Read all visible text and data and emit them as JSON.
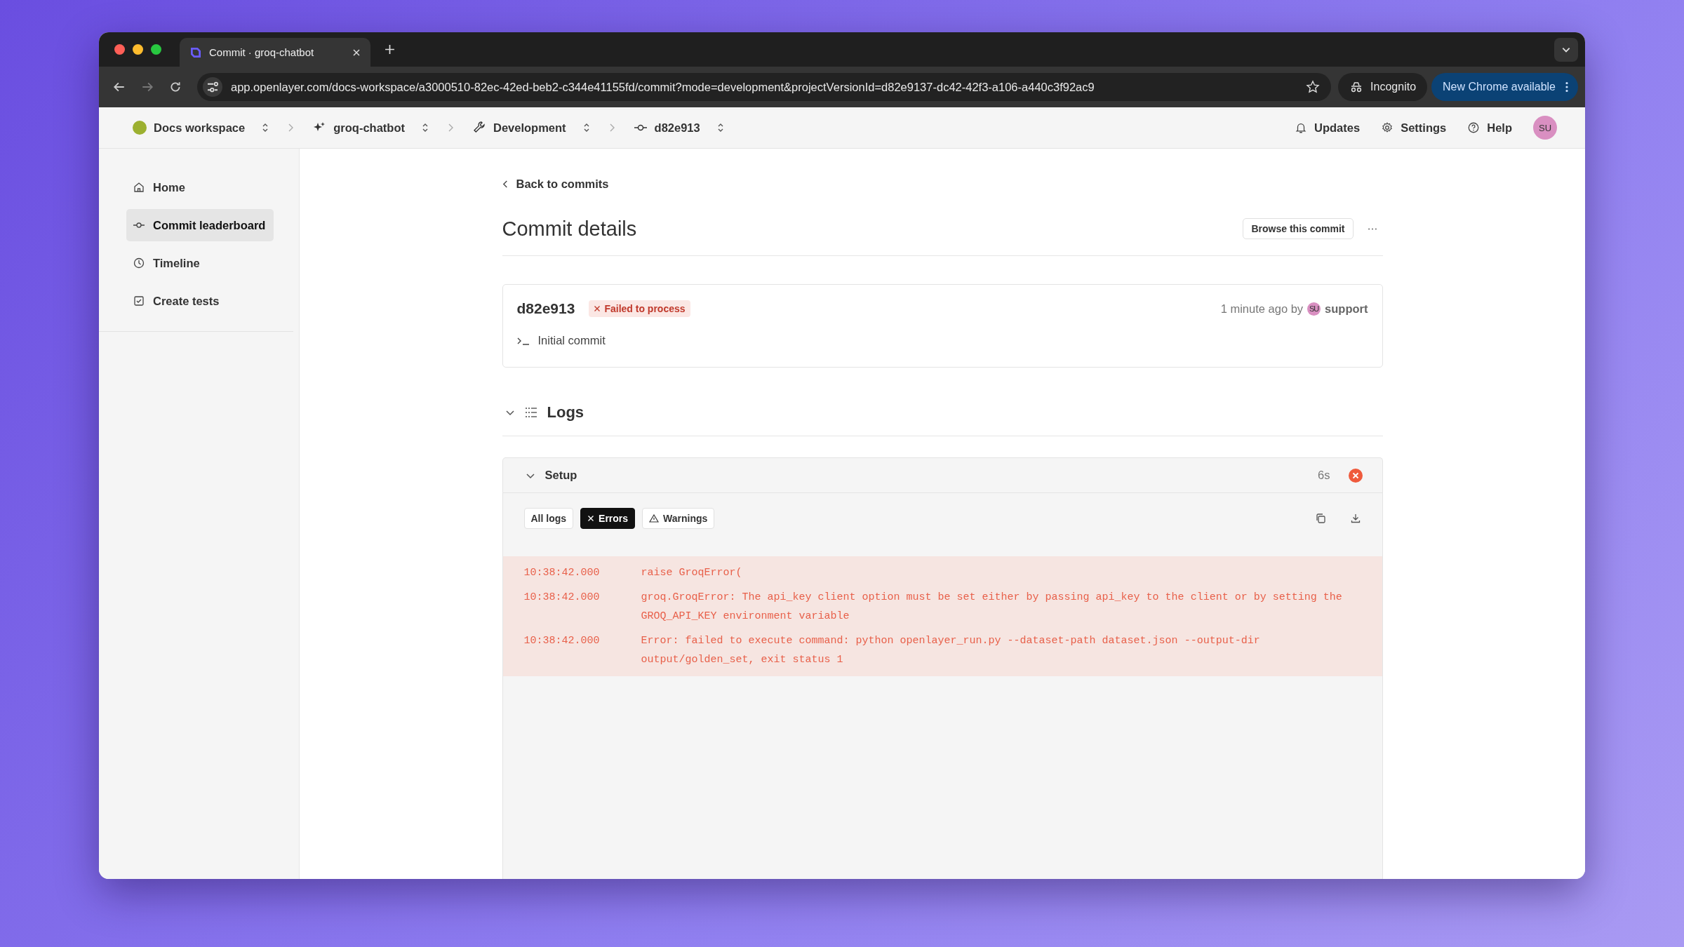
{
  "browser": {
    "tab_title": "Commit · groq-chatbot",
    "url": "app.openlayer.com/docs-workspace/a3000510-82ec-42ed-beb2-c344e41155fd/commit?mode=development&projectVersionId=d82e9137-dc42-42f3-a106-a440c3f92ac9",
    "incognito_label": "Incognito",
    "update_button": "New Chrome available"
  },
  "header": {
    "breadcrumbs": [
      {
        "kind": "workspace",
        "label": "Docs workspace"
      },
      {
        "kind": "project",
        "label": "groq-chatbot"
      },
      {
        "kind": "mode",
        "label": "Development"
      },
      {
        "kind": "commit",
        "label": "d82e913"
      }
    ],
    "actions": [
      {
        "kind": "bell",
        "label": "Updates"
      },
      {
        "kind": "gear",
        "label": "Settings"
      },
      {
        "kind": "help",
        "label": "Help"
      }
    ],
    "avatar": "SU"
  },
  "sidebar": {
    "items": [
      {
        "kind": "home",
        "label": "Home",
        "selected": false
      },
      {
        "kind": "commit",
        "label": "Commit leaderboard",
        "selected": true
      },
      {
        "kind": "clock",
        "label": "Timeline",
        "selected": false
      },
      {
        "kind": "check",
        "label": "Create tests",
        "selected": false
      }
    ]
  },
  "back_link": "Back to commits",
  "title": "Commit details",
  "browse_button": "Browse this commit",
  "commit": {
    "hash": "d82e913",
    "status": "Failed to process",
    "time": "1 minute ago by",
    "author_avatar": "SU",
    "author": "support",
    "message": "Initial commit"
  },
  "logs": {
    "title": "Logs",
    "expanded": true,
    "steps": [
      {
        "name": "Setup",
        "expanded": true,
        "duration": "6s",
        "failed": true,
        "filters": [
          {
            "kind": "all",
            "label": "All logs",
            "selected": false
          },
          {
            "kind": "errors",
            "label": "Errors",
            "selected": true
          },
          {
            "kind": "warnings",
            "label": "Warnings",
            "selected": false
          }
        ],
        "lines": [
          {
            "time": "10:38:42.000",
            "message": "raise GroqError("
          },
          {
            "time": "10:38:42.000",
            "message": "groq.GroqError: The api_key client option must be set either by passing api_key to the client or by setting the GROQ_API_KEY environment variable"
          },
          {
            "time": "10:38:42.000",
            "message": "Error: failed to execute command: python openlayer_run.py --dataset-path dataset.json --output-dir output/golden_set, exit status 1"
          }
        ]
      }
    ]
  }
}
